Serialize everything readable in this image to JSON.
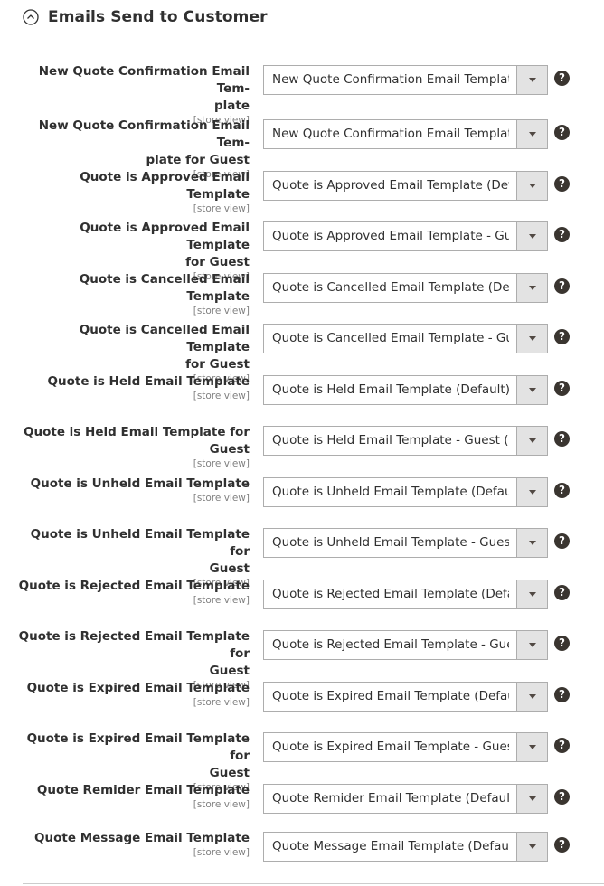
{
  "section": {
    "title": "Emails Send to Customer",
    "icon": "circle-chevron-up-icon"
  },
  "scope_label": "[store view]",
  "help_glyph": "?",
  "fields": [
    {
      "label": "New Quote Confirmation Email Tem-plate",
      "label_lines": [
        "New Quote Confirmation Email Tem-",
        "plate"
      ],
      "value": "New Quote Confirmation Email Template (Default)"
    },
    {
      "label": "New Quote Confirmation Email Template for Guest",
      "label_lines": [
        "New Quote Confirmation Email Tem-",
        "plate for Guest"
      ],
      "value": "New Quote Confirmation Email Template - Guest (Default)"
    },
    {
      "label": "Quote is Approved Email Template",
      "label_lines": [
        "Quote is Approved Email Template"
      ],
      "value": "Quote is Approved Email Template (Default)"
    },
    {
      "label": "Quote is Approved Email Template for Guest",
      "label_lines": [
        "Quote is Approved Email Template",
        "for Guest"
      ],
      "value": "Quote is Approved Email Template - Guest (Default)"
    },
    {
      "label": "Quote is Cancelled Email Template",
      "label_lines": [
        "Quote is Cancelled Email Template"
      ],
      "value": "Quote is Cancelled Email Template (Default)"
    },
    {
      "label": "Quote is Cancelled Email Template for Guest",
      "label_lines": [
        "Quote is Cancelled Email Template",
        "for Guest"
      ],
      "value": "Quote is Cancelled Email Template - Guest (Default)"
    },
    {
      "label": "Quote is Held Email Template",
      "label_lines": [
        "Quote is Held Email Template"
      ],
      "value": "Quote is Held Email Template (Default)"
    },
    {
      "label": "Quote is Held Email Template for Guest",
      "label_lines": [
        "Quote is Held Email Template for",
        "Guest"
      ],
      "value": "Quote is Held Email Template - Guest (Default)"
    },
    {
      "label": "Quote is Unheld Email Template",
      "label_lines": [
        "Quote is Unheld Email Template"
      ],
      "value": "Quote is Unheld Email Template (Default)"
    },
    {
      "label": "Quote is Unheld Email Template for Guest",
      "label_lines": [
        "Quote is Unheld Email Template for",
        "Guest"
      ],
      "value": "Quote is Unheld Email Template - Guest (Default)"
    },
    {
      "label": "Quote is Rejected Email Template",
      "label_lines": [
        "Quote is Rejected Email Template"
      ],
      "value": "Quote is Rejected Email Template (Default)"
    },
    {
      "label": "Quote is Rejected Email Template for Guest",
      "label_lines": [
        "Quote is Rejected Email Template for",
        "Guest"
      ],
      "value": "Quote is Rejected Email Template - Guest (Default)"
    },
    {
      "label": "Quote is Expired Email Template",
      "label_lines": [
        "Quote is Expired Email Template"
      ],
      "value": "Quote is Expired Email Template (Default)"
    },
    {
      "label": "Quote is Expired Email Template for Guest",
      "label_lines": [
        "Quote is Expired Email Template for",
        "Guest"
      ],
      "value": "Quote is Expired Email Template - Guest (Default)"
    },
    {
      "label": "Quote Remider Email Template",
      "label_lines": [
        "Quote Remider Email Template"
      ],
      "value": "Quote Remider Email Template (Default)"
    },
    {
      "label": "Quote Message Email Template",
      "label_lines": [
        "Quote Message Email Template"
      ],
      "value": "Quote Message Email Template (Default)"
    }
  ]
}
